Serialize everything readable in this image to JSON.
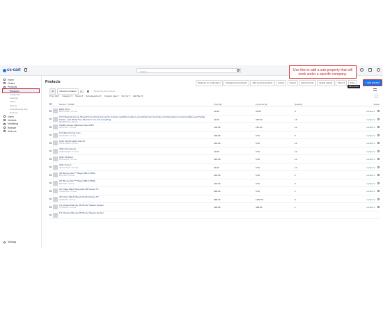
{
  "topbar": {
    "logo": "cs-cart",
    "search_placeholder": "Search"
  },
  "sidebar": {
    "items": [
      {
        "label": "Home"
      },
      {
        "label": "Orders"
      },
      {
        "label": "Products"
      }
    ],
    "sub_items": [
      {
        "label": "Products"
      },
      {
        "label": "Categories"
      },
      {
        "label": "Features"
      },
      {
        "label": "Filters"
      },
      {
        "label": "Options"
      },
      {
        "label": "Hotel Booking App"
      },
      {
        "label": "Reviews"
      }
    ],
    "items_after": [
      {
        "label": "Users"
      },
      {
        "label": "Vendors"
      },
      {
        "label": "Marketing"
      },
      {
        "label": "Website"
      },
      {
        "label": "Add-ons"
      }
    ],
    "settings_label": "Settings"
  },
  "page": {
    "title": "Products",
    "actions": [
      "Products on moderation",
      "Disapproved products",
      "Add several products",
      "Import",
      "Export",
      "Export found",
      "Global update",
      "More ▾",
      "Save"
    ],
    "primary_button": "+ Add product",
    "tooltip": "Add product",
    "callout": "Use this to add a sub-property that will work under a specific company."
  },
  "tabs": {
    "all": "All",
    "recent": "Recently updated",
    "plus": "+",
    "search_placeholder": "Searching all products"
  },
  "filters": [
    "Price ($) ▾",
    "Category ▾",
    "Status ▾",
    "Subcategories ▾",
    "Creation date ▾",
    "Sort by ▾",
    "Add filter ▾"
  ],
  "table": {
    "headers": {
      "name": "Name ▾ / CODE",
      "price": "Price ($)",
      "list_price": "List price ($)",
      "quantity": "Quantity",
      "status": "Status"
    },
    "rows": [
      {
        "name": "Eddy Norm",
        "meta": "EDDYNORM • CS-Cart",
        "price": "30.00",
        "list_price": "31.00",
        "qty": "9",
        "status": "• Active ▾"
      },
      {
        "name": "101 Things Everyone Should Know About Economics: A Down and Dirty Guide to everything from Securities and Derivatives to Interest Rates and Hedge Funds—And What They Mean For You and everything",
        "meta": "B0074PPX7U • CS-Cart",
        "price": "22.00",
        "list_price": "325.00",
        "qty": "15",
        "status": "• Active ▾"
      },
      {
        "name": "16GB A Series Walkman Video MP3",
        "meta": "A0070-M07 • CS-Cart",
        "price": "130.00",
        "list_price": "214.00",
        "qty": "10",
        "status": "• Active ▾"
      },
      {
        "name": "18 Glitter Formal Lens",
        "meta": "N0011LE06 • CS-Cart",
        "price": "399.99",
        "list_price": "0.00",
        "qty": "5",
        "status": "• Active ▾"
      },
      {
        "name": "2010 SOUR GRAP Day DT",
        "meta": "S0014-SOUR • CS-Cart",
        "price": "249.00",
        "list_price": "0.00",
        "qty": "10",
        "status": "• Active ▾"
      },
      {
        "name": "2011 Car Queens",
        "meta": "CARQUEEN11 • CS-Cart",
        "price": "19.95",
        "list_price": "0.00",
        "qty": "10",
        "status": "• Active ▾"
      },
      {
        "name": "2011 VR Box3",
        "meta": "BOXVR0011 • CS-Cart",
        "price": "325.00",
        "list_price": "0.00",
        "qty": "10",
        "status": "• Active ▾"
      },
      {
        "name": "2011 Tycoon",
        "meta": "2011TYCOON • CS-Cart",
        "price": "99.00",
        "list_price": "0.00",
        "qty": "10",
        "status": "• Active ▾"
      },
      {
        "name": "3D Blu-ray Disc™ Player (BD-C7900)",
        "meta": "BDC7900 • CS-Cart",
        "price": "249.00",
        "list_price": "0.00",
        "qty": "2",
        "status": "• Active ▾"
      },
      {
        "name": "3D Blu-ray Disc™ Player (BD-C7500)",
        "meta": "BDC7500 • CS-Cart",
        "price": "249.00",
        "list_price": "0.00",
        "qty": "2",
        "status": "• Active ▾"
      },
      {
        "name": "40\" Class HELP Oleg LED 580 Series TV",
        "meta": "UN40C5000 • CS-Cart",
        "price": "899.00",
        "list_price": "0.00",
        "qty": "1",
        "status": "• Active ▾"
      },
      {
        "name": "46\" Class HELP Oleg LCD 816 Series TV",
        "meta": "LN46C630 • CS-Cart",
        "price": "899.00",
        "list_price": "1100.00",
        "qty": "6",
        "status": "• Active ▾"
      },
      {
        "name": "5.1 Channel Blu-ray 3D Home Theater System",
        "meta": "HTC6500W • CS-Cart",
        "price": "399.00",
        "list_price": "499.00",
        "qty": "1",
        "status": "• Active ▾"
      },
      {
        "name": "5.1 Channel Blu-ray 3D Home Theater System",
        "meta": "",
        "price": "",
        "list_price": "",
        "qty": "",
        "status": ""
      }
    ]
  }
}
